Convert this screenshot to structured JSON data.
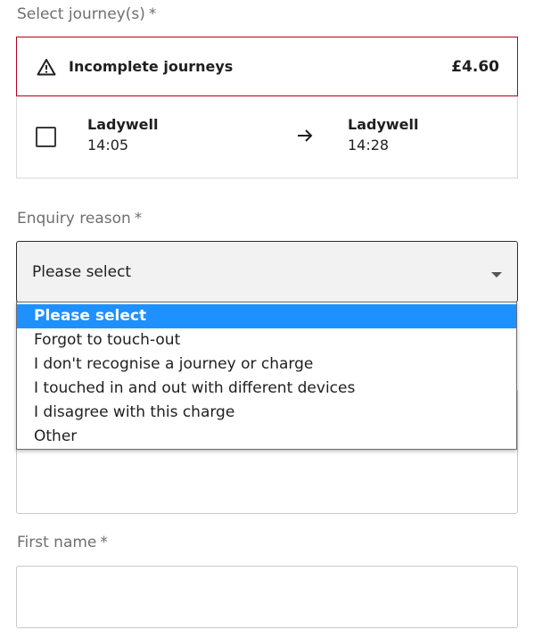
{
  "journeys": {
    "label": "Select journey(s)",
    "required_mark": "*",
    "group_title": "Incomplete journeys",
    "group_price": "£4.60",
    "items": [
      {
        "from_name": "Ladywell",
        "from_time": "14:05",
        "to_name": "Ladywell",
        "to_time": "14:28",
        "checked": false
      }
    ]
  },
  "enquiry": {
    "label": "Enquiry reason",
    "required_mark": "*",
    "selected": "Please select",
    "options": [
      "Please select",
      "Forgot to touch-out",
      "I don't recognise a journey or charge",
      "I touched in and out with different devices",
      "I disagree with this charge",
      "Other"
    ]
  },
  "first_name": {
    "label": "First name",
    "required_mark": "*",
    "value": ""
  },
  "colors": {
    "error_border": "#b3001b",
    "option_highlight": "#1e90ff"
  },
  "icons": {
    "warning": "warning-triangle-icon",
    "arrow": "arrow-right-icon",
    "caret": "caret-down-icon"
  }
}
